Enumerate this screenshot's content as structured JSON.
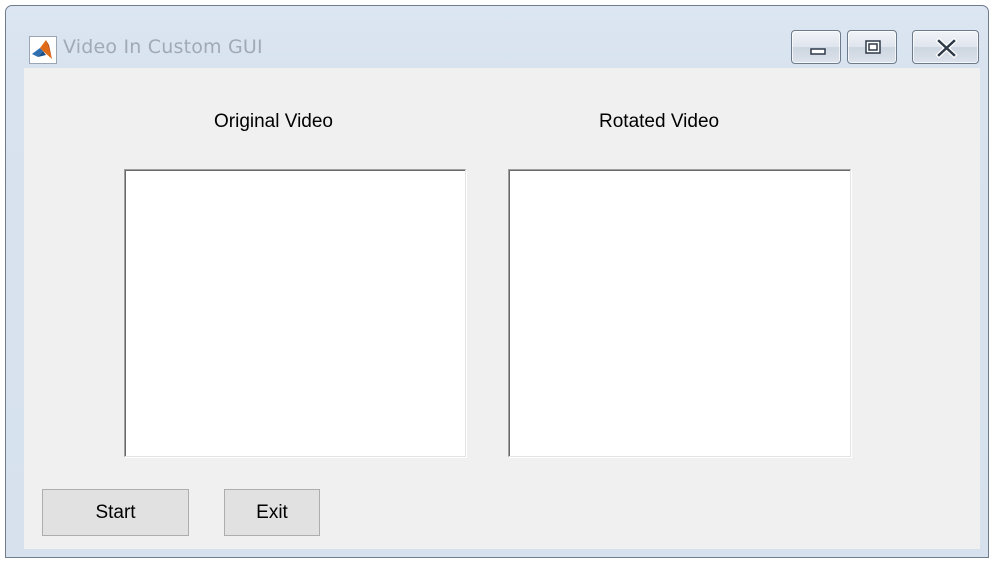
{
  "window": {
    "title": "Video In Custom GUI",
    "icon": "matlab-logo-icon",
    "controls": {
      "minimize_icon": "minimize-icon",
      "maximize_icon": "maximize-icon",
      "close_icon": "close-icon"
    }
  },
  "main": {
    "original_label": "Original Video",
    "rotated_label": "Rotated Video",
    "start_label": "Start",
    "exit_label": "Exit"
  },
  "colors": {
    "client_background": "#f0f0f0",
    "axes_background": "#ffffff",
    "button_background": "#e1e1e1",
    "titlebar": "#d8e3ef",
    "title_text": "#a0aab6"
  }
}
